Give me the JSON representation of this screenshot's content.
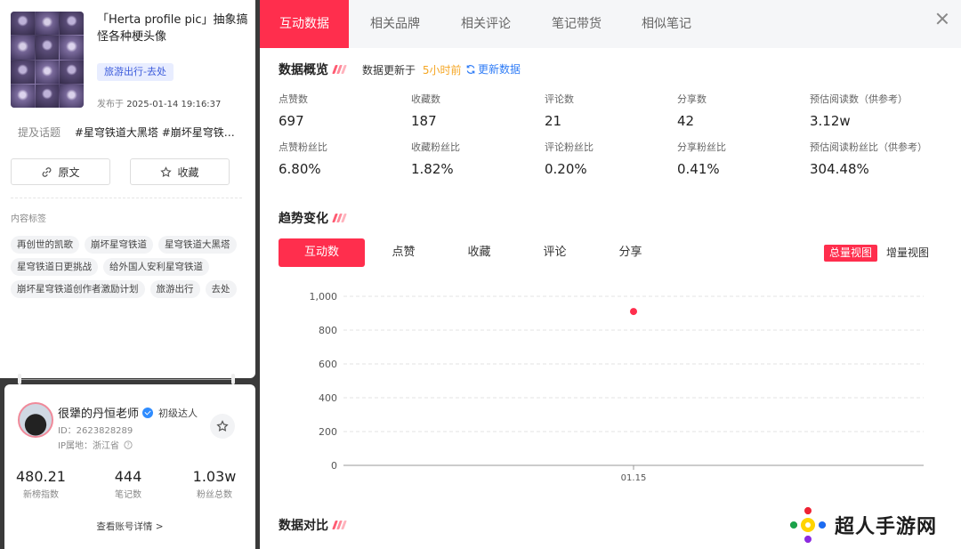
{
  "note": {
    "title": "「Herta profile pic」抽象搞怪各种梗头像",
    "category": "旅游出行-去处",
    "publish_label": "发布于",
    "publish_time": "2025-01-14 19:16:37",
    "topics_label": "提及话题",
    "topics": "#星穹铁道大黑塔 #崩坏星穹铁…",
    "original_button": "原文",
    "favorite_button": "收藏",
    "tags_title": "内容标签",
    "tags": [
      "再创世的凯歌",
      "崩坏星穹铁道",
      "星穹铁道大黑塔",
      "星穹铁道日更挑战",
      "给外国人安利星穹铁道",
      "崩坏星穹铁道创作者激励计划",
      "旅游出行",
      "去处"
    ]
  },
  "author": {
    "name": "很犟的丹恒老师",
    "level": "初级达人",
    "id": "ID：2623828289",
    "ip": "IP属地：浙江省",
    "stats": [
      {
        "value": "480.21",
        "label": "新榜指数"
      },
      {
        "value": "444",
        "label": "笔记数"
      },
      {
        "value": "1.03w",
        "label": "粉丝总数"
      }
    ],
    "account_link": "查看账号详情 >"
  },
  "tabs": [
    "互动数据",
    "相关品牌",
    "相关评论",
    "笔记带货",
    "相似笔记"
  ],
  "overview": {
    "title": "数据概览",
    "update_prefix": "数据更新于",
    "update_time": "5小时前",
    "update_button": "更新数据",
    "metrics_row1": [
      {
        "label": "点赞数",
        "value": "697"
      },
      {
        "label": "收藏数",
        "value": "187"
      },
      {
        "label": "评论数",
        "value": "21"
      },
      {
        "label": "分享数",
        "value": "42"
      },
      {
        "label": "预估阅读数（供参考）",
        "value": "3.12w"
      }
    ],
    "metrics_row2": [
      {
        "label": "点赞粉丝比",
        "value": "6.80%"
      },
      {
        "label": "收藏粉丝比",
        "value": "1.82%"
      },
      {
        "label": "评论粉丝比",
        "value": "0.20%"
      },
      {
        "label": "分享粉丝比",
        "value": "0.41%"
      },
      {
        "label": "预估阅读粉丝比（供参考）",
        "value": "304.48%"
      }
    ]
  },
  "trend": {
    "title": "趋势变化",
    "subtabs": [
      "互动数",
      "点赞",
      "收藏",
      "评论",
      "分享"
    ],
    "views": [
      "总量视图",
      "增量视图"
    ]
  },
  "chart_data": {
    "type": "scatter",
    "categories": [
      "01.15"
    ],
    "values": [
      910
    ],
    "ylim": [
      0,
      1000
    ],
    "yticks": [
      "0",
      "200",
      "400",
      "600",
      "800",
      "1,000"
    ],
    "grid": true,
    "point_color": "#ff2e4d"
  },
  "compare": {
    "title": "数据对比"
  },
  "watermark": "超人手游网",
  "colors": {
    "accent": "#ff2e4d",
    "link": "#2f7cf6",
    "highlight": "#f5a623"
  }
}
